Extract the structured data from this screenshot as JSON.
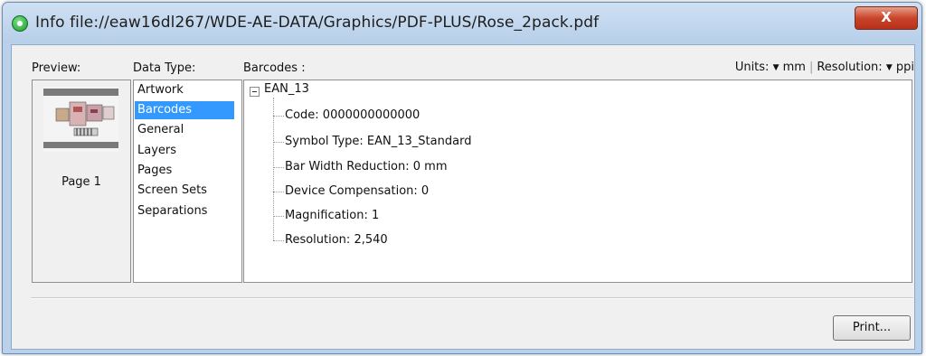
{
  "window": {
    "title": "Info file://eaw16dl267/WDE-AE-DATA/Graphics/PDF-PLUS/Rose_2pack.pdf",
    "close_label": "X"
  },
  "preview": {
    "label": "Preview:",
    "page_label": "Page 1"
  },
  "data_type": {
    "label": "Data Type:",
    "items": [
      "Artwork",
      "Barcodes",
      "General",
      "Layers",
      "Pages",
      "Screen Sets",
      "Separations"
    ],
    "selected": "Barcodes"
  },
  "barcodes": {
    "label": "Barcodes :",
    "units_label": "Units:",
    "units_value": "mm",
    "resolution_label": "Resolution:",
    "resolution_value": "ppi",
    "tree": {
      "root": "EAN_13",
      "children": [
        "Code:  0000000000000",
        "Symbol Type: EAN_13_Standard",
        "Bar Width Reduction:  0 mm",
        "Device Compensation: 0",
        "Magnification: 1",
        "Resolution:  2,540"
      ]
    }
  },
  "buttons": {
    "print_label": "Print..."
  }
}
